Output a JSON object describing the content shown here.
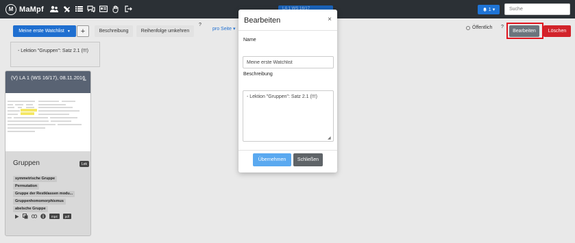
{
  "app": {
    "title": "MaMpf",
    "logo_letter": "M"
  },
  "navbar": {
    "icons": [
      "users-icon",
      "tools-icon",
      "list-icon",
      "comments-icon",
      "card-icon",
      "hand-icon",
      "logout-icon"
    ],
    "center_button": "LA 1 WS 16/17",
    "notification_count": "1",
    "search_placeholder": "Suche"
  },
  "toolbar": {
    "watchlist_label": "Meine erste Watchlist",
    "add_label": "+",
    "description_label": "Beschreibung",
    "order_label": "Reihenfolge umkehren",
    "help_mark": "?",
    "per_page_label": "pro Seite",
    "public_label": "Öffentlich",
    "edit_label": "Bearbeiten",
    "delete_label": "Löschen"
  },
  "description_box": {
    "text": "- Lektion \"Gruppen\": Satz 2.1 (!!!)"
  },
  "card": {
    "header": "(V) LA 1 (WS 16/17), 08.11.2016",
    "collapse_icon": "−",
    "title": "Gruppen",
    "badge": "Lek",
    "tags": [
      "symmetrische Gruppe",
      "Permutation",
      "Gruppe der Restklassen modu...",
      "Gruppenhomomorphismus",
      "abelsche Gruppe"
    ],
    "footer_badges": [
      "mp4",
      "pdf"
    ]
  },
  "modal": {
    "title": "Bearbeiten",
    "close": "×",
    "name_label": "Name",
    "name_value": "Meine erste Watchlist",
    "description_label": "Beschreibung",
    "description_value": "- Lektion \"Gruppen\": Satz 2.1 (!!!)",
    "apply_label": "Übernehmen",
    "close_label": "Schließen"
  },
  "colors": {
    "navbar": "#2b3035",
    "primary": "#1f6fd0",
    "danger": "#d2232a",
    "secondary": "#6c757d",
    "highlight_border": "#e0141e",
    "card_header": "#596373"
  }
}
